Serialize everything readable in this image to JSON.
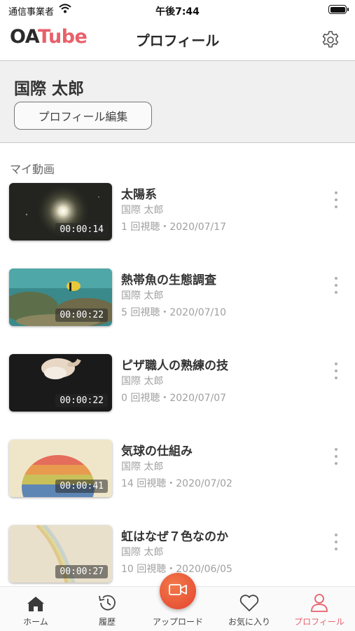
{
  "status_bar": {
    "carrier": "通信事業者",
    "time": "午後7:44"
  },
  "header": {
    "logo_oa": "OA",
    "logo_tube": "Tube",
    "title": "プロフィール"
  },
  "profile": {
    "name": "国際 太郎",
    "edit_button": "プロフィール編集"
  },
  "section_label": "マイ動画",
  "videos": [
    {
      "title": "太陽系",
      "channel": "国際 太郎",
      "meta": "1 回視聴・2020/07/17",
      "duration": "00:00:14"
    },
    {
      "title": "熱帯魚の生態調査",
      "channel": "国際 太郎",
      "meta": "5 回視聴・2020/07/10",
      "duration": "00:00:22"
    },
    {
      "title": "ピザ職人の熟練の技",
      "channel": "国際 太郎",
      "meta": "0 回視聴・2020/07/07",
      "duration": "00:00:22"
    },
    {
      "title": "気球の仕組み",
      "channel": "国際 太郎",
      "meta": "14 回視聴・2020/07/02",
      "duration": "00:00:41"
    },
    {
      "title": "虹はなぜ７色なのか",
      "channel": "国際 太郎",
      "meta": "10 回視聴・2020/06/05",
      "duration": "00:00:27"
    }
  ],
  "tabs": {
    "home": "ホーム",
    "history": "履歴",
    "upload": "アップロード",
    "favorites": "お気に入り",
    "profile": "プロフィール"
  },
  "colors": {
    "brand": "#e8606a",
    "upload": "#e4432f"
  },
  "icons": {
    "settings": "gear-icon",
    "more": "more-vertical-icon",
    "home": "home-icon",
    "history": "history-icon",
    "upload": "video-camera-icon",
    "favorites": "heart-icon",
    "profile": "person-icon"
  }
}
